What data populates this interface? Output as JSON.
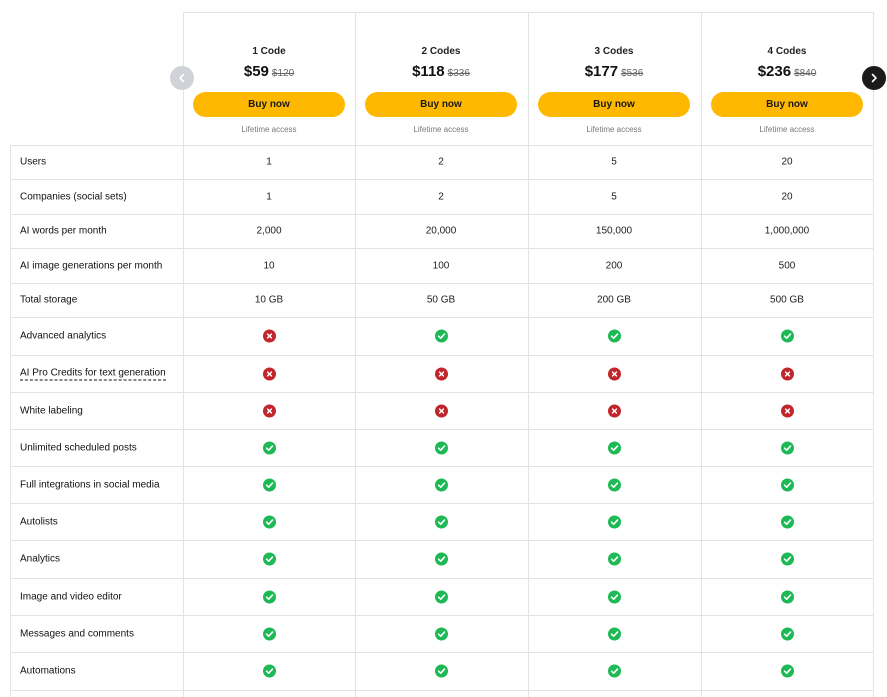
{
  "plans": [
    {
      "name": "1 Code",
      "price": "$59",
      "old_price": "$120",
      "button": "Buy now",
      "note": "Lifetime access"
    },
    {
      "name": "2 Codes",
      "price": "$118",
      "old_price": "$336",
      "button": "Buy now",
      "note": "Lifetime access"
    },
    {
      "name": "3 Codes",
      "price": "$177",
      "old_price": "$536",
      "button": "Buy now",
      "note": "Lifetime access"
    },
    {
      "name": "4 Codes",
      "price": "$236",
      "old_price": "$840",
      "button": "Buy now",
      "note": "Lifetime access"
    }
  ],
  "nav": {
    "prev_icon": "chevron-left-icon",
    "next_icon": "chevron-right-icon"
  },
  "features": [
    {
      "label": "Users",
      "values": [
        "1",
        "2",
        "5",
        "20"
      ]
    },
    {
      "label": "Companies (social sets)",
      "values": [
        "1",
        "2",
        "5",
        "20"
      ]
    },
    {
      "label": "AI words per month",
      "values": [
        "2,000",
        "20,000",
        "150,000",
        "1,000,000"
      ]
    },
    {
      "label": "AI image generations per month",
      "values": [
        "10",
        "100",
        "200",
        "500"
      ]
    },
    {
      "label": "Total storage",
      "values": [
        "10 GB",
        "50 GB",
        "200 GB",
        "500 GB"
      ]
    },
    {
      "label": "Advanced analytics",
      "values": [
        "no",
        "yes",
        "yes",
        "yes"
      ]
    },
    {
      "label": "AI Pro Credits for text generation",
      "tooltip": true,
      "values": [
        "no",
        "no",
        "no",
        "no"
      ]
    },
    {
      "label": "White labeling",
      "values": [
        "no",
        "no",
        "no",
        "no"
      ]
    },
    {
      "label": "Unlimited scheduled posts",
      "values": [
        "yes",
        "yes",
        "yes",
        "yes"
      ]
    },
    {
      "label": "Full integrations in social media",
      "values": [
        "yes",
        "yes",
        "yes",
        "yes"
      ]
    },
    {
      "label": "Autolists",
      "values": [
        "yes",
        "yes",
        "yes",
        "yes"
      ]
    },
    {
      "label": "Analytics",
      "values": [
        "yes",
        "yes",
        "yes",
        "yes"
      ]
    },
    {
      "label": "Image and video editor",
      "values": [
        "yes",
        "yes",
        "yes",
        "yes"
      ]
    },
    {
      "label": "Messages and comments",
      "values": [
        "yes",
        "yes",
        "yes",
        "yes"
      ]
    },
    {
      "label": "Automations",
      "values": [
        "yes",
        "yes",
        "yes",
        "yes"
      ]
    }
  ],
  "colors": {
    "yes": "#1db954",
    "no": "#c0262b",
    "button": "#ffb800"
  }
}
